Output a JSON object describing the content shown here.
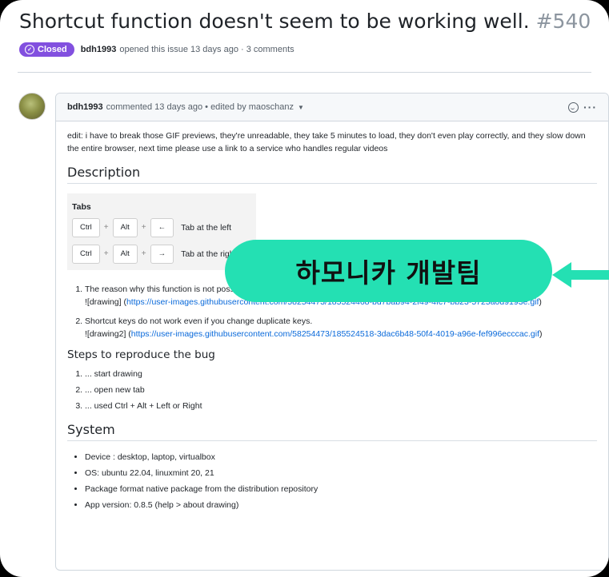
{
  "issue": {
    "title": "Shortcut function doesn't seem to be working well.",
    "number": "#540",
    "status_label": "Closed",
    "author": "bdh1993",
    "meta_text": "opened this issue 13 days ago · 3 comments"
  },
  "comment": {
    "author": "bdh1993",
    "header_text": "commented 13 days ago • edited by maoschanz",
    "edit_note": "edit: i have to break those GIF previews, they're unreadable, they take 5 minutes to load, they don't even play correctly, and they slow down the entire browser, next time please use a link to a service who handles regular videos",
    "description_heading": "Description",
    "tabs_image": {
      "title": "Tabs",
      "rows": [
        {
          "k1": "Ctrl",
          "k2": "Alt",
          "k3": "←",
          "label": "Tab at the left"
        },
        {
          "k1": "Ctrl",
          "k2": "Alt",
          "k3": "→",
          "label": "Tab at the right"
        }
      ]
    },
    "issues": [
      {
        "text": "The reason why this function is not possible",
        "img_ref": "![drawing]",
        "link": "https://user-images.githubusercontent.com/58254473/185524468-bd7bab94-2f49-4fc7-bb23-5725a0d9193e.gif"
      },
      {
        "text": "Shortcut keys do not work even if you change duplicate keys.",
        "img_ref": "![drawing2]",
        "link": "https://user-images.githubusercontent.com/58254473/185524518-3dac6b48-50f4-4019-a96e-fef996ecccac.gif"
      }
    ],
    "steps_heading": "Steps to reproduce the bug",
    "steps": [
      "... start drawing",
      "... open new tab",
      "... used Ctrl + Alt + Left or Right"
    ],
    "system_heading": "System",
    "system": [
      "Device : desktop, laptop, virtualbox",
      "OS: ubuntu 22.04, linuxmint 20, 21",
      "Package format native package from the distribution repository",
      "App version: 0.8.5 (help > about drawing)"
    ]
  },
  "overlay": {
    "text": "하모니카 개발팀",
    "color": "#24e0b3"
  }
}
